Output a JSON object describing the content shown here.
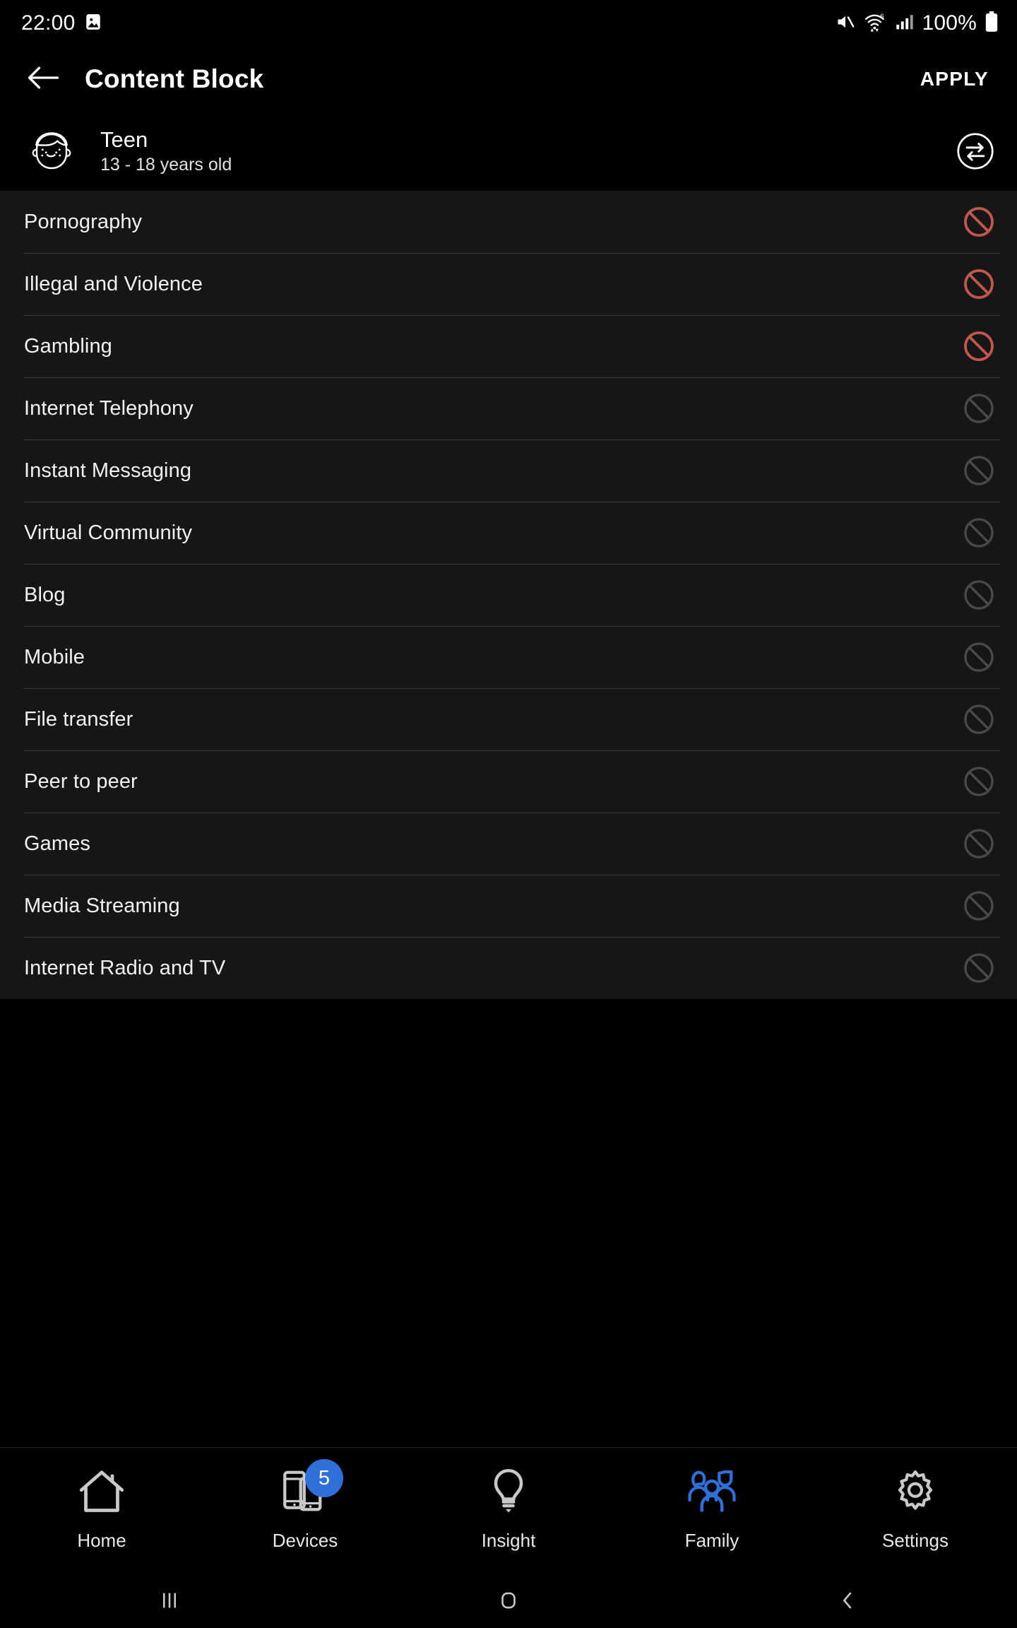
{
  "status_bar": {
    "time": "22:00",
    "battery_percent": "100%",
    "icons": [
      "image-icon",
      "mute-icon",
      "wifi-6-icon",
      "signal-bars-icon",
      "battery-icon"
    ]
  },
  "app_bar": {
    "back_icon": "back-arrow-icon",
    "title": "Content Block",
    "apply_label": "APPLY"
  },
  "profile": {
    "avatar_icon": "teen-face-avatar",
    "name": "Teen",
    "age_range": "13 - 18 years old",
    "swap_icon": "swap-arrows-icon"
  },
  "colors": {
    "blocked": "#c0564e",
    "allowed": "#4a4a4a",
    "accent": "#2f6fd8",
    "list_bg": "#161616",
    "page_bg": "#000000"
  },
  "content_list": [
    {
      "label": "Pornography",
      "state": "blocked"
    },
    {
      "label": "Illegal and Violence",
      "state": "blocked"
    },
    {
      "label": "Gambling",
      "state": "blocked"
    },
    {
      "label": "Internet Telephony",
      "state": "allowed"
    },
    {
      "label": "Instant Messaging",
      "state": "allowed"
    },
    {
      "label": "Virtual Community",
      "state": "allowed"
    },
    {
      "label": "Blog",
      "state": "allowed"
    },
    {
      "label": "Mobile",
      "state": "allowed"
    },
    {
      "label": "File transfer",
      "state": "allowed"
    },
    {
      "label": "Peer to peer",
      "state": "allowed"
    },
    {
      "label": "Games",
      "state": "allowed"
    },
    {
      "label": "Media Streaming",
      "state": "allowed"
    },
    {
      "label": "Internet Radio and TV",
      "state": "allowed"
    }
  ],
  "bottom_nav": {
    "items": [
      {
        "label": "Home",
        "icon": "home-icon",
        "active": false,
        "badge": null
      },
      {
        "label": "Devices",
        "icon": "devices-icon",
        "active": false,
        "badge": "5"
      },
      {
        "label": "Insight",
        "icon": "lightbulb-icon",
        "active": false,
        "badge": null
      },
      {
        "label": "Family",
        "icon": "family-group-icon",
        "active": true,
        "badge": null
      },
      {
        "label": "Settings",
        "icon": "gear-icon",
        "active": false,
        "badge": null
      }
    ]
  },
  "system_nav": {
    "buttons": [
      "recents-icon",
      "home-square-icon",
      "back-chevron-icon"
    ]
  }
}
